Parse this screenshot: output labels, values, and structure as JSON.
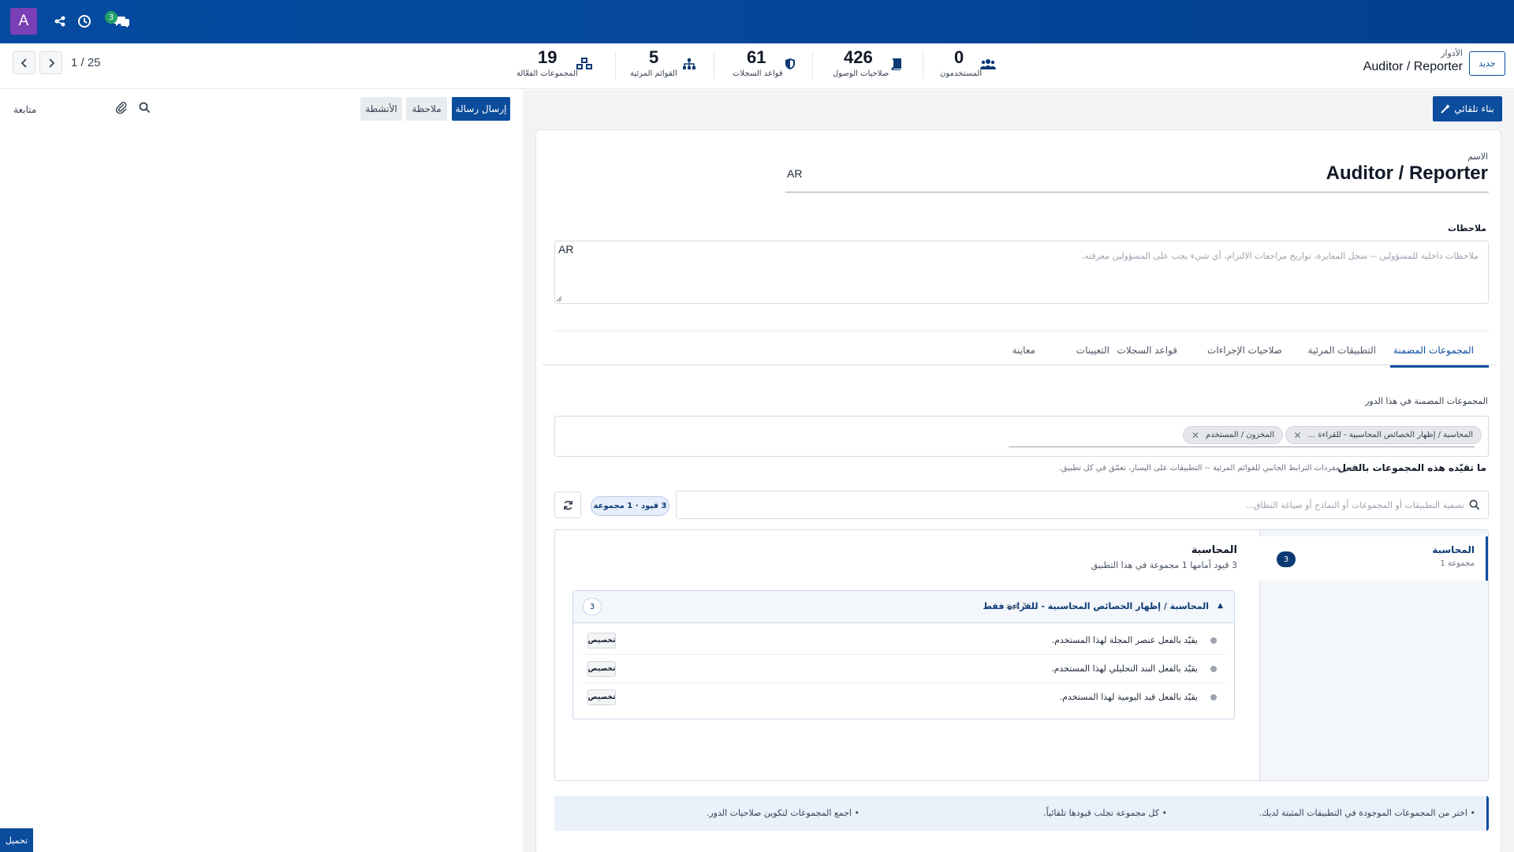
{
  "navbar": {
    "avatar_letter": "A",
    "chat_badge": "3",
    "icons": [
      "share-nodes-icon",
      "clock-icon",
      "chat-icon"
    ],
    "brand_color": "#054a9e",
    "avatar_color": "#7a3fb6"
  },
  "control": {
    "pager": "1 / 25",
    "breadcrumb_parent": "الأدوار",
    "breadcrumb_title": "Auditor / Reporter",
    "new_label": "جديد",
    "stats": [
      {
        "num": "0",
        "label": "المستخدمون",
        "icon": "users-icon"
      },
      {
        "num": "426",
        "label": "صلاحيات الوصول",
        "icon": "book-icon"
      },
      {
        "num": "61",
        "label": "قواعد السجلات",
        "icon": "shield-icon"
      },
      {
        "num": "5",
        "label": "القوائم المرئية",
        "icon": "sitemap-icon"
      },
      {
        "num": "19",
        "label": "المجموعات الفعّالة",
        "icon": "cubes-icon"
      }
    ]
  },
  "chatter": {
    "send_label": "إرسال رسالة",
    "note_label": "ملاحظة",
    "activities_label": "الأنشطة",
    "follow_label": "متابعة",
    "upload_label": "تحميل"
  },
  "form": {
    "auto_build_label": "بناء تلقائي",
    "name_label": "الاسم",
    "name_value": "Auditor / Reporter",
    "lang_tag": "AR",
    "notes_label": "ملاحظات",
    "notes_placeholder": "ملاحظات داخلية للمسؤولين -- سجل المعايرة، تواريخ مراجعات الالتزام، أي شيء يجب على المسؤولين معرفته.",
    "notes_lang_tag": "AR",
    "tabs": [
      "المجموعات المضمنة",
      "التطبيقات المرئية",
      "صلاحيات الإجراءات",
      "قواعد السجلات",
      "التعيينات",
      "معاينة"
    ],
    "groups_label": "المجموعات المضمنة في هذا الدور",
    "groups_chips": [
      "المحاسبة / إظهار الخصائص المحاسبية - للقراءة ...",
      "المخزون / المستخدم"
    ],
    "restrict_title": "ما تقيّده هذه المجموعات بالفعل",
    "restrict_sub": "نفس مفردات الترابط الجانبي للقوائم المرئية -- التطبيقات على اليسار، تعمّق في كل تطبيق.",
    "search_placeholder": "تصفية التطبيقات أو المجموعات أو النماذج أو صياغة النطاق...",
    "count_pill": "3 قيود · 1 مجموعة",
    "side_app_title": "المحاسبة",
    "side_app_sub": "1 مجموعة",
    "side_app_count": "3",
    "detail_title": "المحاسبة",
    "detail_sub": "3 قيود أمامها 1 مجموعة في هذا التطبيق",
    "group_title": "المحاسبة / إظهار الخصائص المحاسبية - للقراءة فقط",
    "group_count_text": "3 قيود",
    "group_badge": "3",
    "rules": [
      {
        "text": "يقيّد بالفعل عنصر المجلة لهذا المستخدم.",
        "btn": "تخصيص"
      },
      {
        "text": "يقيّد بالفعل البند التحليلي لهذا المستخدم.",
        "btn": "تخصيص"
      },
      {
        "text": "يقيّد بالفعل قيد اليومية لهذا المستخدم.",
        "btn": "تخصيص"
      }
    ],
    "hints": [
      "اختر من المجموعات الموجودة في التطبيقات المثبتة لديك.",
      "كل مجموعة تجلب قيودها تلقائياً.",
      "اجمع المجموعات لتكوين صلاحيات الدور."
    ]
  }
}
